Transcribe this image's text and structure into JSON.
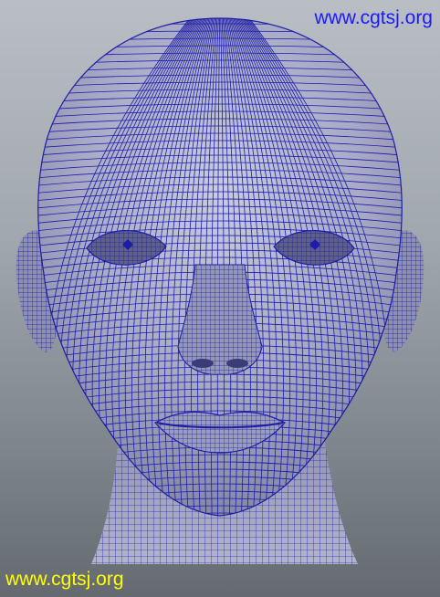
{
  "watermark_top": "www.cgtsj.org",
  "watermark_bottom": "www.cgtsj.org",
  "colors": {
    "watermark_top": "#1a1aff",
    "watermark_bottom": "#ffff00",
    "wire": "#1c1ca6",
    "skin": "#a6a8c4",
    "background_top": "#b9bec5",
    "background_bottom": "#646a70"
  },
  "icons": [
    "head-wireframe-model"
  ]
}
